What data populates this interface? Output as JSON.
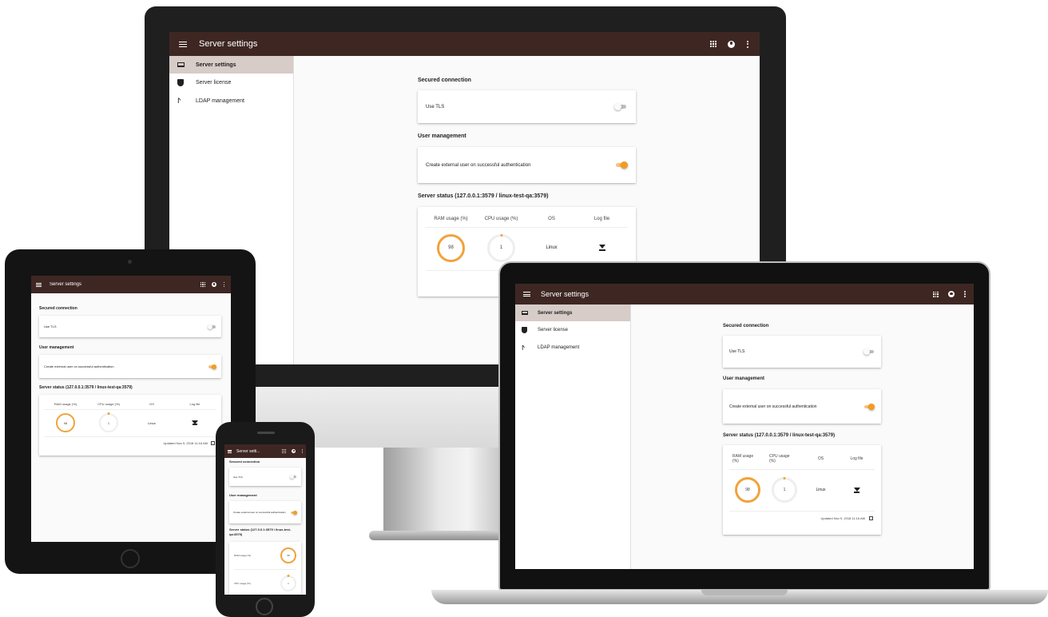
{
  "app": {
    "title": "Server settings",
    "title_truncated": "Server setti..."
  },
  "icons": {
    "menu": "menu-icon",
    "apps": "apps-grid-icon",
    "account": "account-circle-icon",
    "more": "more-vert-icon",
    "laptop": "laptop-icon",
    "shield": "shield-icon",
    "network": "network-icon",
    "download": "download-icon",
    "calendar": "calendar-icon"
  },
  "colors": {
    "appbar": "#3e2723",
    "accent": "#f39c1f",
    "selected_nav": "#d7ccc8"
  },
  "sidebar": {
    "items": [
      {
        "label": "Server settings",
        "selected": true
      },
      {
        "label": "Server license",
        "selected": false
      },
      {
        "label": "LDAP management",
        "selected": false
      }
    ]
  },
  "secured_connection": {
    "title": "Secured connection",
    "use_tls_label": "Use TLS",
    "use_tls_enabled": false
  },
  "user_management": {
    "title": "User management",
    "create_external_label": "Create external user on successful authentication",
    "create_external_enabled": true
  },
  "server_status": {
    "title": "Server status (127.0.0.1:3579 / linux-test-qa:3579)",
    "title_wrap_line1": "Server status (127.0.0.1:3579 / linux-test-",
    "title_wrap_line2": "qa:3579)",
    "headers": {
      "ram": "RAM usage (%)",
      "cpu": "CPU usage (%)",
      "os": "OS",
      "log": "Log file"
    },
    "headers_wrapped": {
      "ram_line1": "RAM usage",
      "ram_line2": "(%)",
      "cpu_line1": "CPU usage",
      "cpu_line2": "(%)"
    },
    "ram_value": "98",
    "cpu_value": "1",
    "os_value": "Linux",
    "updated": "Updated Nov 9, 2018 11:16 AM"
  }
}
